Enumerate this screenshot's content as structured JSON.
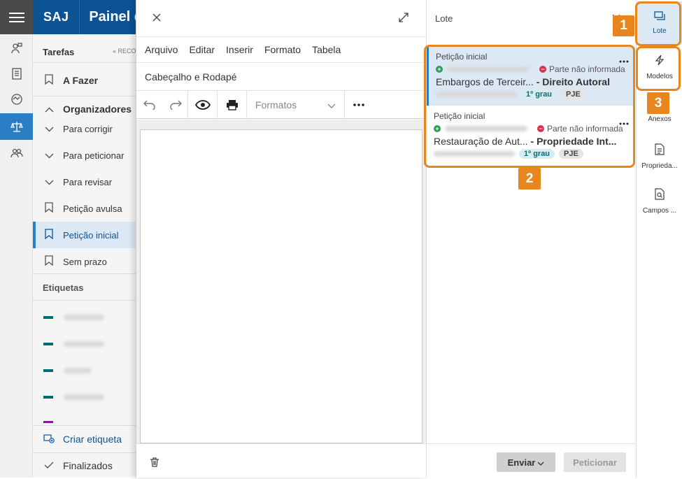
{
  "app": {
    "brand": "SAJ",
    "title": "Painel de"
  },
  "rail": {
    "icons": [
      "menu-icon",
      "user-tag-icon",
      "clipboard-icon",
      "handshake-icon",
      "scales-icon",
      "people-icon"
    ]
  },
  "side": {
    "tasks_title": "Tarefas",
    "collapse_label": "« RECO",
    "a_fazer": "A Fazer",
    "organizadores": "Organizadores",
    "items": [
      "Para corrigir",
      "Para peticionar",
      "Para revisar",
      "Petição avulsa",
      "Petição inicial",
      "Sem prazo"
    ],
    "etiquetas_title": "Etiquetas",
    "create_tag": "Criar etiqueta",
    "finalizados": "Finalizados"
  },
  "editor": {
    "menu": [
      "Arquivo",
      "Editar",
      "Inserir",
      "Formato",
      "Tabela"
    ],
    "header_footer": "Cabeçalho e Rodapé",
    "formats_placeholder": "Formatos"
  },
  "lote": {
    "title": "Lote",
    "cards": [
      {
        "type": "Petição inicial",
        "party_status": "Parte não informada",
        "subject": "Embargos de Terceir...",
        "category": "- Direito Autoral",
        "grau": "1º grau",
        "system": "PJE"
      },
      {
        "type": "Petição inicial",
        "party_status": "Parte não informada",
        "subject": "Restauração de Aut...",
        "category": "- Propriedade Int...",
        "grau": "1º grau",
        "system": "PJE"
      }
    ],
    "send_label": "Enviar",
    "petition_label": "Peticionar"
  },
  "right_rail": {
    "items": [
      {
        "label": "Lote",
        "icon": "batch-icon"
      },
      {
        "label": "Modelos",
        "icon": "lightning-icon"
      },
      {
        "label": "Anexos",
        "icon": "attachment-icon"
      },
      {
        "label": "Proprieda...",
        "icon": "document-properties-icon"
      },
      {
        "label": "Campos ...",
        "icon": "document-search-icon"
      }
    ]
  },
  "callouts": [
    "1",
    "2",
    "3"
  ],
  "colors": {
    "brand": "#0b5394",
    "accent": "#2a7fc4",
    "callout": "#e8861d",
    "tag": "#006d75"
  }
}
